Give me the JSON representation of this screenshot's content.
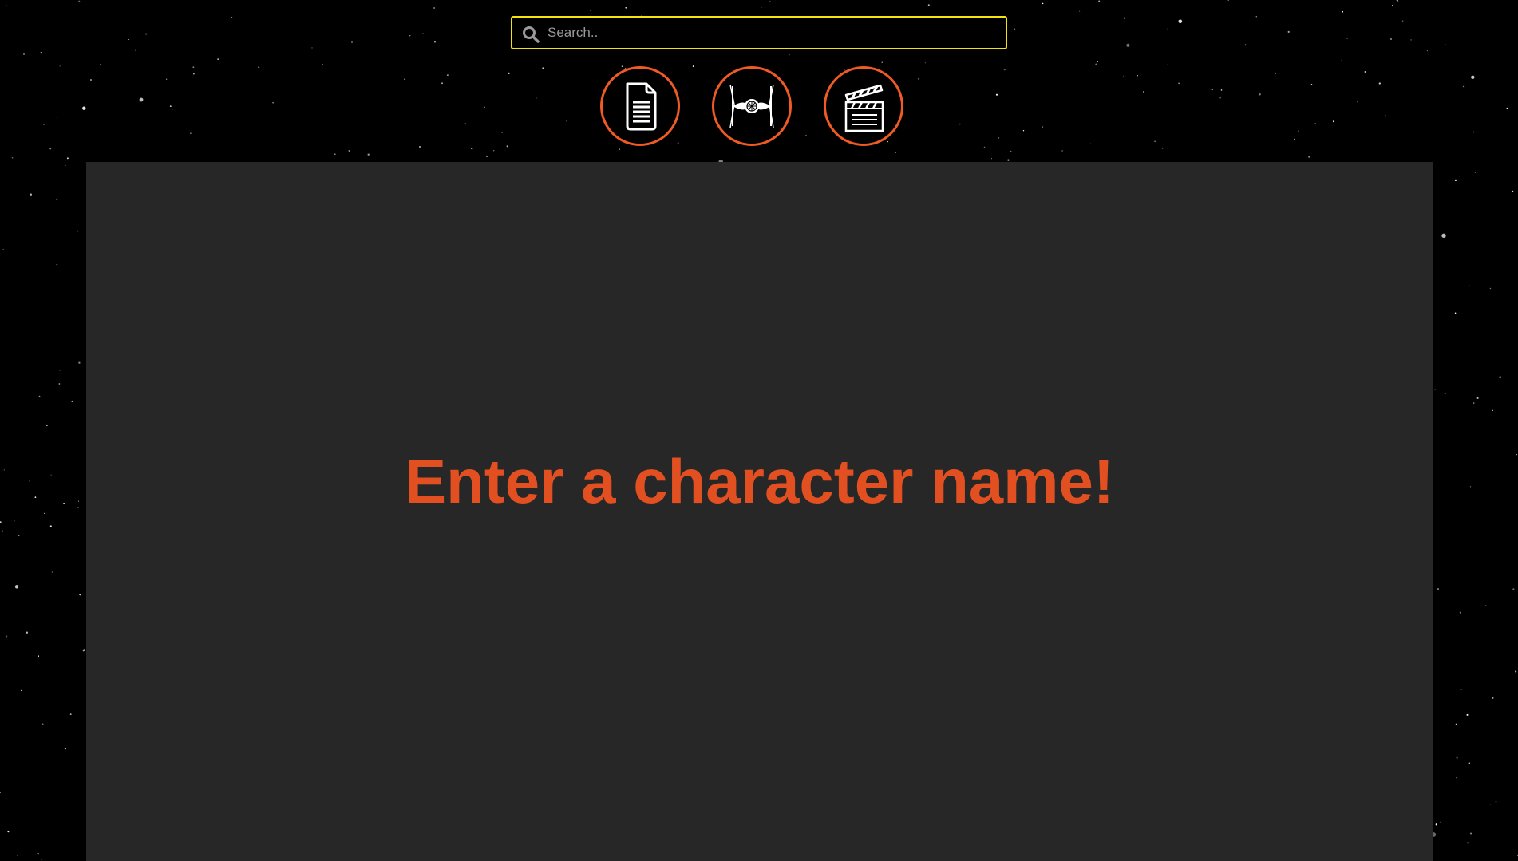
{
  "search": {
    "placeholder": "Search..",
    "value": ""
  },
  "nav": {
    "buttons": [
      {
        "icon": "document-icon"
      },
      {
        "icon": "tie-fighter-icon"
      },
      {
        "icon": "clapperboard-icon"
      }
    ]
  },
  "main": {
    "prompt": "Enter a character name!"
  },
  "colors": {
    "background": "#000000",
    "panel": "#272727",
    "accent": "#ef5a25",
    "prompt_text": "#e25022",
    "search_border": "#f2e20f",
    "icon": "#ffffff"
  }
}
